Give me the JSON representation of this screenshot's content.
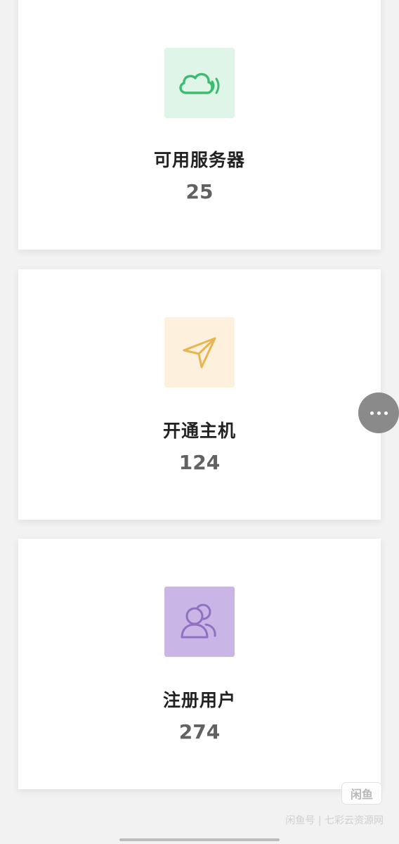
{
  "stats": [
    {
      "label": "可用服务器",
      "value": "25",
      "icon": "cloud-signal-icon",
      "color": "#3dbb70",
      "bg": "#def5e7"
    },
    {
      "label": "开通主机",
      "value": "124",
      "icon": "send-arrow-icon",
      "color": "#e9b552",
      "bg": "#fdf0dc"
    },
    {
      "label": "注册用户",
      "value": "274",
      "icon": "users-icon",
      "color": "#9070c0",
      "bg": "#c9b6e6"
    }
  ],
  "watermark": {
    "logo": "闲鱼",
    "text": "闲鱼号 | 七彩云资源网"
  }
}
